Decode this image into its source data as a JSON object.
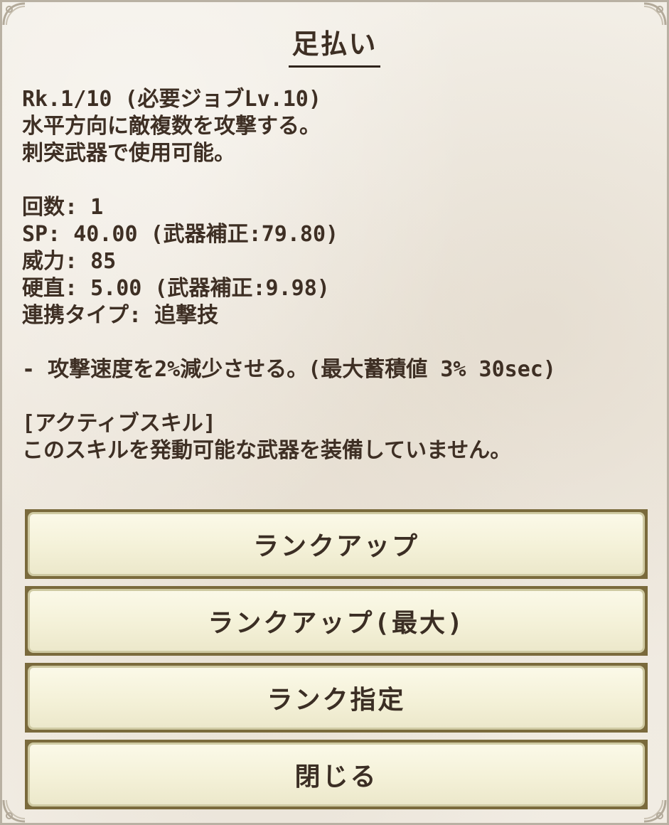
{
  "dialog": {
    "title": "足払い",
    "lines": {
      "rank": "Rk.1/10 (必要ジョブLv.10)",
      "desc1": "水平方向に敵複数を攻撃する。",
      "desc2": "刺突武器で使用可能。",
      "hits": "回数: 1",
      "sp": "SP: 40.00 (武器補正:79.80)",
      "power": "威力: 85",
      "stiffness": "硬直: 5.00 (武器補正:9.98)",
      "combo": "連携タイプ: 追撃技",
      "effect": "- 攻撃速度を2%減少させる。(最大蓄積値 3% 30sec)",
      "active_header": "[アクティブスキル]",
      "active_note": "このスキルを発動可能な武器を装備していません。"
    }
  },
  "buttons": {
    "rank_up": "ランクアップ",
    "rank_up_max": "ランクアップ(最大)",
    "rank_set": "ランク指定",
    "close": "閉じる"
  }
}
